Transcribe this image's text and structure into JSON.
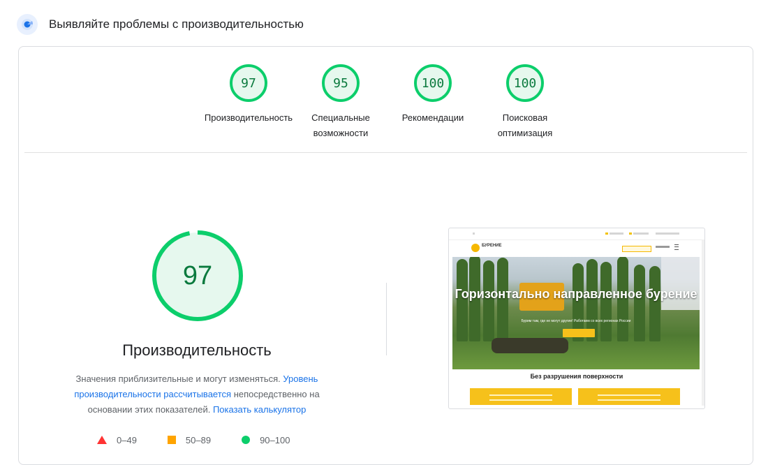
{
  "header": {
    "title": "Выявляйте проблемы с производительностью",
    "icon": "lighthouse-icon"
  },
  "categories": [
    {
      "score": "97",
      "label": "Производительность"
    },
    {
      "score": "95",
      "label": "Специальные возможности"
    },
    {
      "score": "100",
      "label": "Рекомендации"
    },
    {
      "score": "100",
      "label": "Поисковая оптимизация"
    }
  ],
  "performance": {
    "score": "97",
    "score_value": 97,
    "title": "Производительность",
    "desc_part1": "Значения приблизительные и могут изменяться. ",
    "desc_link1": "Уровень производительности рассчитывается",
    "desc_part2": " непосредственно на основании этих показателей. ",
    "desc_link2": "Показать калькулятор"
  },
  "legend": [
    {
      "range": "0–49",
      "icon": "triangle-icon"
    },
    {
      "range": "50–89",
      "icon": "square-icon"
    },
    {
      "range": "90–100",
      "icon": "circle-icon"
    }
  ],
  "screenshot": {
    "brand": "БУРЕНИЕ",
    "hero_title": "Горизонтально направленное бурение",
    "hero_subtitle": "Бурим там, где не могут другие! Работаем со всех регионах России",
    "section_title": "Без разрушения поверхности"
  },
  "colors": {
    "pass": "#0cce6b",
    "average": "#ffa400",
    "fail": "#ff3333",
    "link": "#1a73e8"
  }
}
